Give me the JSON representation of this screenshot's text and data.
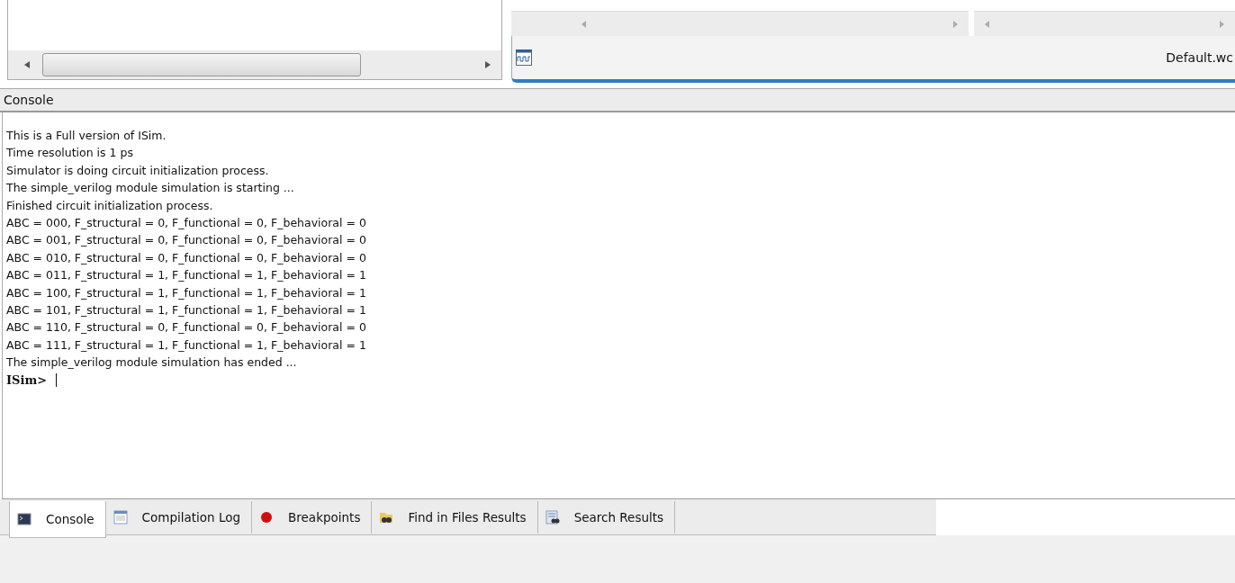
{
  "top_panel": {
    "file_tab": "Default.wc"
  },
  "console": {
    "title": "Console",
    "lines": [
      "This is a Full version of ISim.",
      "Time resolution is 1 ps",
      "Simulator is doing circuit initialization process.",
      "The simple_verilog module simulation is starting ...",
      "Finished circuit initialization process.",
      "ABC = 000, F_structural = 0, F_functional = 0, F_behavioral = 0",
      "ABC = 001, F_structural = 0, F_functional = 0, F_behavioral = 0",
      "ABC = 010, F_structural = 0, F_functional = 0, F_behavioral = 0",
      "ABC = 011, F_structural = 1, F_functional = 1, F_behavioral = 1",
      "ABC = 100, F_structural = 1, F_functional = 1, F_behavioral = 1",
      "ABC = 101, F_structural = 1, F_functional = 1, F_behavioral = 1",
      "ABC = 110, F_structural = 0, F_functional = 0, F_behavioral = 0",
      "ABC = 111, F_structural = 1, F_functional = 1, F_behavioral = 1",
      "The simple_verilog module simulation has ended ..."
    ],
    "prompt": "ISim>"
  },
  "tabs": [
    {
      "label": "Console",
      "kind": "console",
      "selected": true
    },
    {
      "label": "Compilation Log",
      "kind": "log",
      "selected": false
    },
    {
      "label": "Breakpoints",
      "kind": "breakpoint",
      "selected": false
    },
    {
      "label": "Find in Files Results",
      "kind": "find",
      "selected": false
    },
    {
      "label": "Search Results",
      "kind": "search",
      "selected": false
    }
  ]
}
